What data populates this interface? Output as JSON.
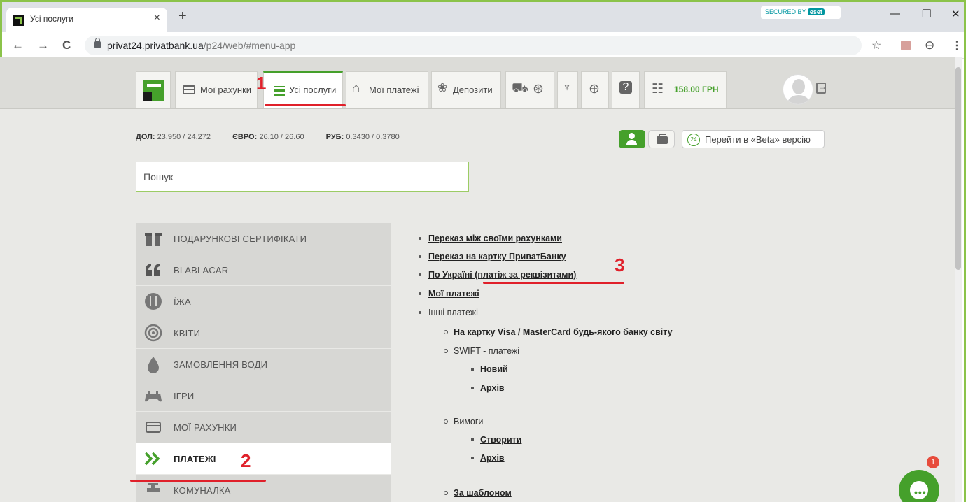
{
  "browser": {
    "tab_title": "Усі послуги",
    "tab_close": "×",
    "new_tab": "+",
    "eset_text": "SECURED BY",
    "eset_brand": "eset",
    "url_host": "privat24.privatbank.ua",
    "url_path": "/p24/web/#menu-app",
    "min": "—",
    "restore": "❐",
    "close": "✕",
    "back": "←",
    "forward": "→",
    "reload": "C",
    "star": "☆",
    "account": "⊖",
    "menu": "⋮"
  },
  "topnav": {
    "accounts": "Мої рахунки",
    "services": "Усі послуги",
    "payments": "Мої платежі",
    "deposits": "Депозити",
    "cart_amount": "158.00 ГРН"
  },
  "rates": [
    {
      "label": "ДОЛ:",
      "value": "23.950 / 24.272"
    },
    {
      "label": "ЄВРО:",
      "value": "26.10 / 26.60"
    },
    {
      "label": "РУБ:",
      "value": "0.3430 / 0.3780"
    }
  ],
  "beta": {
    "badge": "24",
    "label": "Перейти в «Beta» версію"
  },
  "search": {
    "placeholder": "Пошук"
  },
  "categories": [
    {
      "label": "ПОДАРУНКОВІ СЕРТИФІКАТИ",
      "icon": "gift-icon"
    },
    {
      "label": "BLABLACAR",
      "icon": "quote-icon"
    },
    {
      "label": "ЇЖА",
      "icon": "food-icon"
    },
    {
      "label": "КВІТИ",
      "icon": "flower-icon"
    },
    {
      "label": "ЗАМОВЛЕННЯ ВОДИ",
      "icon": "water-drop-icon"
    },
    {
      "label": "ІГРИ",
      "icon": "gamepad-icon"
    },
    {
      "label": "МОЇ РАХУНКИ",
      "icon": "card-icon"
    },
    {
      "label": "ПЛАТЕЖІ",
      "icon": "double-chevron-icon"
    },
    {
      "label": "КОМУНАЛКА",
      "icon": "faucet-icon"
    }
  ],
  "links": {
    "l1": "Переказ між своїми рахунками",
    "l2": "Переказ на картку ПриватБанку",
    "l3": "По Україні (платіж за реквізитами)",
    "l4": "Мої платежі",
    "l5": "Інші платежі",
    "l6": "На картку Visa / MasterCard будь-якого банку світу",
    "l7": "SWIFT - платежі",
    "l8": "Новий",
    "l9": "Архів",
    "l10": "Вимоги",
    "l11": "Створити",
    "l12": "Архів",
    "l13": "За шаблоном"
  },
  "annotations": {
    "a1": "1",
    "a2": "2",
    "a3": "3"
  },
  "chat": {
    "badge": "1",
    "dots": "•••"
  },
  "colors": {
    "brand_green": "#45a02b",
    "annotation_red": "#e0202a"
  }
}
